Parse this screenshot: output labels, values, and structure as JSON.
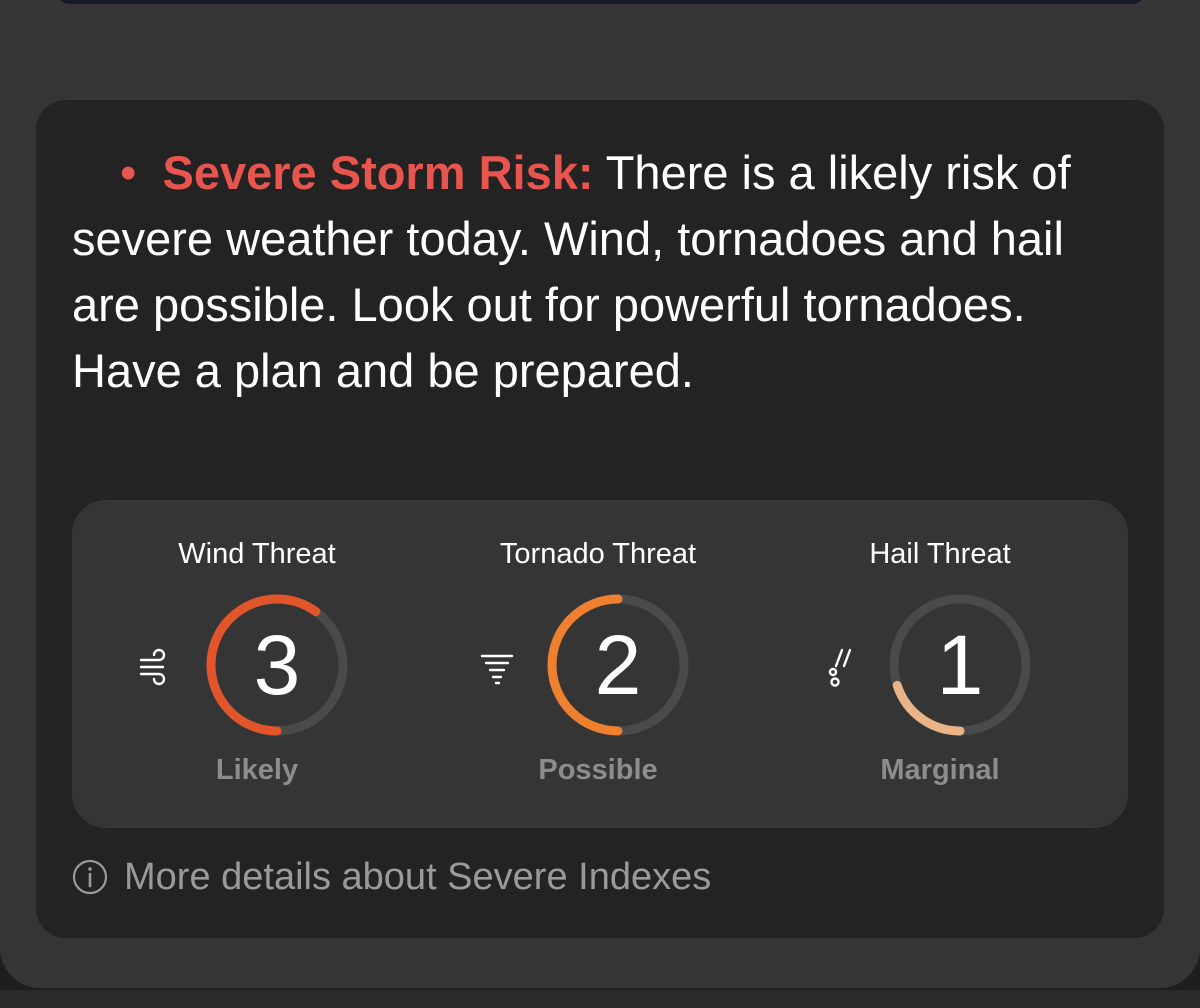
{
  "colors": {
    "risk_red": "#e8554e",
    "wind_arc": "#e2552a",
    "tornado_arc": "#ef8030",
    "hail_arc": "#e9b487",
    "track": "#4a4a4a"
  },
  "risk": {
    "bullet": "•",
    "label": "Severe Storm Risk:",
    "text": " There is a likely risk of severe weather today. Wind, tornadoes and hail are possible. Look out for powerful tornadoes. Have a plan and be prepared."
  },
  "threats": [
    {
      "title": "Wind Threat",
      "value": "3",
      "level": "Likely",
      "fill_fraction": 0.6,
      "icon": "wind-icon"
    },
    {
      "title": "Tornado Threat",
      "value": "2",
      "level": "Possible",
      "fill_fraction": 0.5,
      "icon": "tornado-icon"
    },
    {
      "title": "Hail Threat",
      "value": "1",
      "level": "Marginal",
      "fill_fraction": 0.2,
      "icon": "hail-icon"
    }
  ],
  "more_details": {
    "icon": "info-icon",
    "label": "More details about Severe Indexes"
  }
}
